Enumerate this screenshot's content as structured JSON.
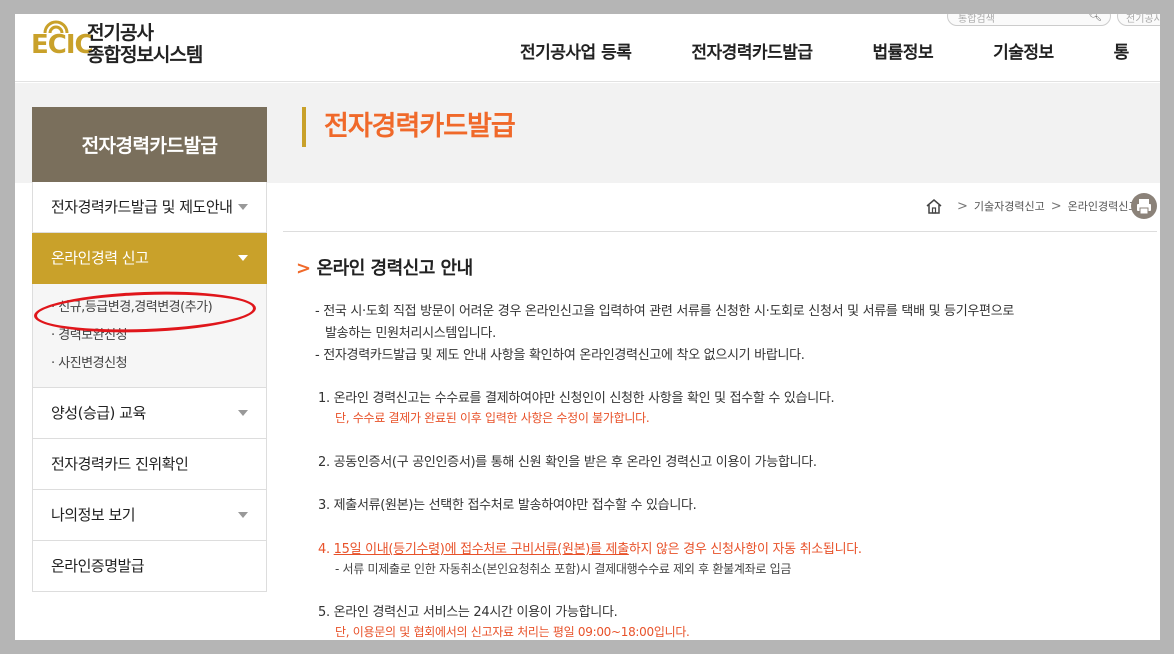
{
  "header": {
    "logo_mark": "ECIC",
    "logo_line1": "전기공사",
    "logo_line2": "종합정보시스템",
    "search_placeholder": "통합검색",
    "search2_text": "전기공사업",
    "nav": [
      "전기공사업 등록",
      "전자경력카드발급",
      "법률정보",
      "기술정보",
      "통"
    ]
  },
  "sidebar": {
    "title": "전자경력카드발급",
    "items": [
      {
        "label": "전자경력카드발급 및 제도안내"
      },
      {
        "label": "온라인경력 신고"
      },
      {
        "label": "양성(승급) 교육"
      },
      {
        "label": "전자경력카드 진위확인"
      },
      {
        "label": "나의정보 보기"
      },
      {
        "label": "온라인증명발급"
      }
    ],
    "submenu": [
      "· 신규,등급변경,경력변경(추가)",
      "· 경력보완신청",
      "· 사진변경신청"
    ]
  },
  "content": {
    "page_title": "전자경력카드발급",
    "breadcrumb": [
      "기술자경력신고",
      "온라인경력신고"
    ],
    "section_title": "온라인 경력신고 안내",
    "intro": [
      "- 전국 시·도회 직접 방문이 어려운 경우 온라인신고을 입력하여 관련 서류를 신청한 시·도회로 신청서 및 서류를 택배 및 등기우편으로",
      "발송하는 민원처리시스템입니다.",
      "- 전자경력카드발급 및 제도 안내 사항을 확인하여 온라인경력신고에 착오 없으시기 바랍니다."
    ],
    "item1": "1. 온라인 경력신고는 수수료를 결제하여야만 신청인이 신청한 사항을 확인 및 접수할 수 있습니다.",
    "item1_note": "단, 수수료 결제가 완료된 이후 입력한 사항은 수정이 불가합니다.",
    "item2": "2. 공동인증서(구 공인인증서)를 통해 신원 확인을 받은 후 온라인 경력신고 이용이 가능합니다.",
    "item3": "3. 제출서류(원본)는 선택한 접수처로 발송하여야만 접수할 수 있습니다.",
    "item4_prefix": "4. ",
    "item4_underlined": "15일 이내(등기수령)에 접수처로 구비서류(원본)를 제출",
    "item4_rest": "하지 않은 경우 신청사항이 자동 취소됩니다.",
    "item4_note": "- 서류 미제출로 인한 자동취소(본인요청취소 포함)시 결제대행수수료 제외 후 환불계좌로 입금",
    "item5": "5. 온라인 경력신고 서비스는 24시간 이용이 가능합니다.",
    "item5_note": "단, 이용문의 및 협회에서의 신고자료 처리는 평일 09:00~18:00입니다."
  },
  "colors": {
    "accent": "#c9a12a",
    "title_orange": "#f0692a",
    "note_red": "#e8522a",
    "sidebar_title_bg": "#7a6f5c"
  }
}
